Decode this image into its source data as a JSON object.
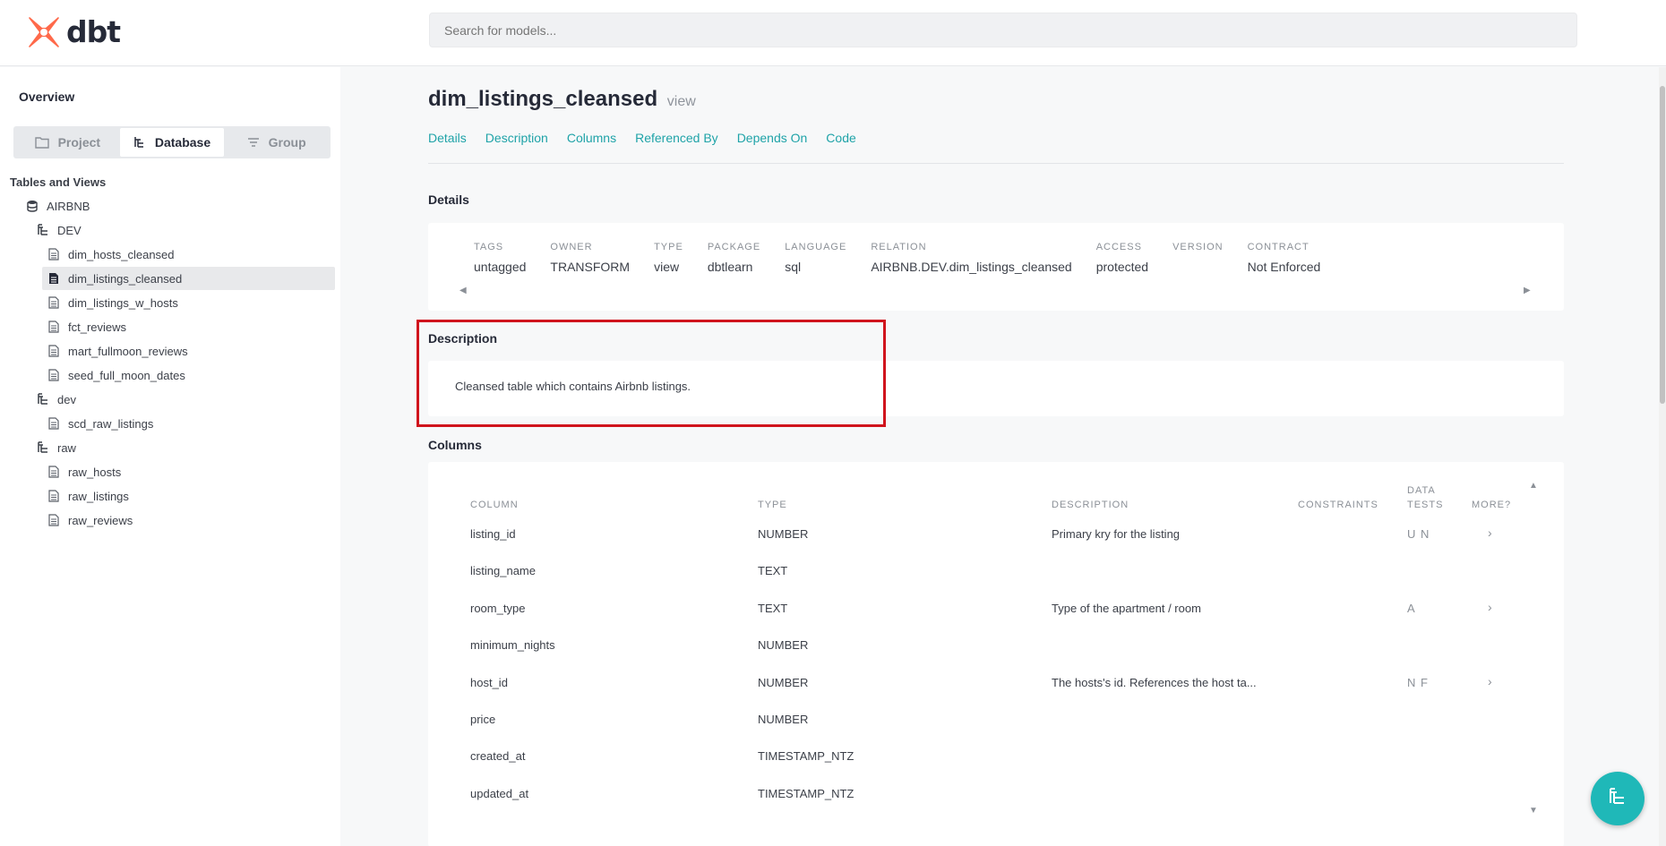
{
  "header": {
    "logo_text": "dbt",
    "search_placeholder": "Search for models..."
  },
  "sidebar": {
    "overview": "Overview",
    "switcher": [
      {
        "label": "Project",
        "icon": "folder-icon"
      },
      {
        "label": "Database",
        "icon": "tree-icon"
      },
      {
        "label": "Group",
        "icon": "filter-icon"
      }
    ],
    "active_switch": "Database",
    "section_title": "Tables and Views",
    "tree": [
      {
        "label": "AIRBNB",
        "type": "database"
      },
      {
        "label": "DEV",
        "type": "schema"
      },
      {
        "label": "dim_hosts_cleansed",
        "type": "model"
      },
      {
        "label": "dim_listings_cleansed",
        "type": "model",
        "selected": true
      },
      {
        "label": "dim_listings_w_hosts",
        "type": "model"
      },
      {
        "label": "fct_reviews",
        "type": "model"
      },
      {
        "label": "mart_fullmoon_reviews",
        "type": "model"
      },
      {
        "label": "seed_full_moon_dates",
        "type": "model"
      },
      {
        "label": "dev",
        "type": "schema"
      },
      {
        "label": "scd_raw_listings",
        "type": "model"
      },
      {
        "label": "raw",
        "type": "schema"
      },
      {
        "label": "raw_hosts",
        "type": "model"
      },
      {
        "label": "raw_listings",
        "type": "model"
      },
      {
        "label": "raw_reviews",
        "type": "model"
      }
    ]
  },
  "main": {
    "title": "dim_listings_cleansed",
    "kind": "view",
    "tabs": [
      "Details",
      "Description",
      "Columns",
      "Referenced By",
      "Depends On",
      "Code"
    ],
    "details_title": "Details",
    "details": [
      {
        "label": "TAGS",
        "value": "untagged"
      },
      {
        "label": "OWNER",
        "value": "TRANSFORM"
      },
      {
        "label": "TYPE",
        "value": "view"
      },
      {
        "label": "PACKAGE",
        "value": "dbtlearn"
      },
      {
        "label": "LANGUAGE",
        "value": "sql"
      },
      {
        "label": "RELATION",
        "value": "AIRBNB.DEV.dim_listings_cleansed"
      },
      {
        "label": "ACCESS",
        "value": "protected"
      },
      {
        "label": "VERSION",
        "value": ""
      },
      {
        "label": "CONTRACT",
        "value": "Not Enforced"
      }
    ],
    "description_title": "Description",
    "description_text": "Cleansed table which contains Airbnb listings.",
    "columns_title": "Columns",
    "columns_headers": {
      "column": "COLUMN",
      "type": "TYPE",
      "description": "DESCRIPTION",
      "constraints": "CONSTRAINTS",
      "data_tests_1": "DATA",
      "data_tests_2": "TESTS",
      "more": "MORE?"
    },
    "columns": [
      {
        "name": "listing_id",
        "type": "NUMBER",
        "description": "Primary kry for the listing",
        "tests": "U N",
        "more": "›"
      },
      {
        "name": "listing_name",
        "type": "TEXT",
        "description": "",
        "tests": "",
        "more": ""
      },
      {
        "name": "room_type",
        "type": "TEXT",
        "description": "Type of the apartment / room",
        "tests": "A",
        "more": "›"
      },
      {
        "name": "minimum_nights",
        "type": "NUMBER",
        "description": "",
        "tests": "",
        "more": ""
      },
      {
        "name": "host_id",
        "type": "NUMBER",
        "description": "The hosts's id. References the host ta...",
        "tests": "N F",
        "more": "›"
      },
      {
        "name": "price",
        "type": "NUMBER",
        "description": "",
        "tests": "",
        "more": ""
      },
      {
        "name": "created_at",
        "type": "TIMESTAMP_NTZ",
        "description": "",
        "tests": "",
        "more": ""
      },
      {
        "name": "updated_at",
        "type": "TIMESTAMP_NTZ",
        "description": "",
        "tests": "",
        "more": ""
      }
    ]
  },
  "colors": {
    "accent": "#1fa3a8",
    "highlight": "#d0141d",
    "brand": "#ff694a"
  }
}
